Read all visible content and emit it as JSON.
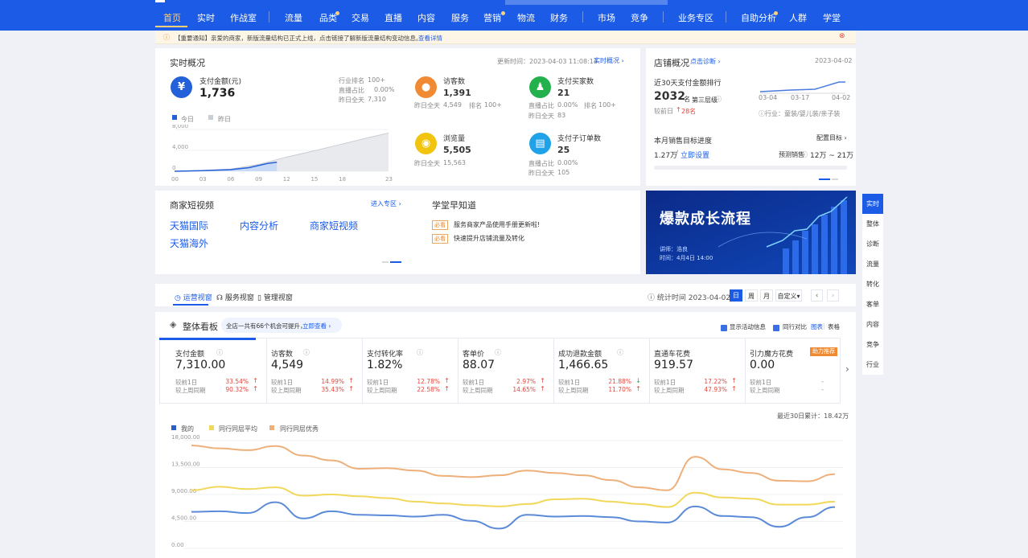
{
  "nav": {
    "items": [
      "首页",
      "实时",
      "作战室",
      "流量",
      "品类",
      "交易",
      "直播",
      "内容",
      "服务",
      "营销",
      "物流",
      "财务",
      "市场",
      "竞争",
      "业务专区",
      "自助分析",
      "人群",
      "学堂"
    ]
  },
  "notice": {
    "text": "【重要通知】亲爱的商家，新版流量结构已正式上线，点击链接了解新版流量结构变动信息。",
    "link": "查看详情"
  },
  "realtime": {
    "title": "实时概况",
    "update_time": "更新时间：2023-04-03 11:08:14",
    "link": "实时概况",
    "pay_amount": {
      "label": "支付金额(元)",
      "value": "1,736",
      "rank_label": "行业排名",
      "rank": "100+",
      "live_label": "直播占比",
      "live": "0.00%",
      "yday_label": "昨日全天",
      "yday": "7,310"
    },
    "visitors": {
      "label": "访客数",
      "value": "1,391",
      "yday_label": "昨日全天",
      "yday": "4,549",
      "rank_label": "排名",
      "rank": "100+"
    },
    "buyers": {
      "label": "支付买家数",
      "value": "21",
      "live_label": "直播占比",
      "live": "0.00%",
      "rank_label": "排名",
      "rank": "100+",
      "yday_label": "昨日全天",
      "yday": "83"
    },
    "views": {
      "label": "浏览量",
      "value": "5,505",
      "yday_label": "昨日全天",
      "yday": "15,563"
    },
    "suborders": {
      "label": "支付子订单数",
      "value": "25",
      "live_label": "直播占比",
      "live": "0.00%",
      "yday_label": "昨日全天",
      "yday": "105"
    },
    "legend": {
      "today": "今日",
      "yesterday": "昨日"
    },
    "icons": {
      "pay": "yen-icon",
      "visitors": "footprint-icon",
      "buyers": "users-icon",
      "views": "eye-icon",
      "suborders": "order-icon"
    }
  },
  "mini_chart": {
    "type": "area",
    "x_ticks": [
      "00",
      "03",
      "06",
      "09",
      "12",
      "15",
      "18",
      "23"
    ],
    "y_ticks": [
      "8,000",
      "4,000",
      "0"
    ],
    "ylim": [
      0,
      8000
    ],
    "today": [
      {
        "h": 0,
        "v": 0
      },
      {
        "h": 3,
        "v": 120
      },
      {
        "h": 6,
        "v": 300
      },
      {
        "h": 8,
        "v": 700
      },
      {
        "h": 9,
        "v": 1100
      },
      {
        "h": 10,
        "v": 1500
      },
      {
        "h": 11,
        "v": 1736
      }
    ],
    "yesterday": [
      {
        "h": 0,
        "v": 0
      },
      {
        "h": 3,
        "v": 150
      },
      {
        "h": 6,
        "v": 400
      },
      {
        "h": 9,
        "v": 1300
      },
      {
        "h": 12,
        "v": 2700
      },
      {
        "h": 15,
        "v": 3900
      },
      {
        "h": 18,
        "v": 5200
      },
      {
        "h": 21,
        "v": 6500
      },
      {
        "h": 23,
        "v": 7310
      }
    ]
  },
  "shop": {
    "title": "店铺概况",
    "diag": "点击诊断",
    "date": "2023-04-02",
    "rank_title": "近30天支付金额排行",
    "rank": "2032",
    "rank_unit": "名",
    "tier": "第三层级",
    "compare": "较前日",
    "change": "28名",
    "spark_dates": [
      "03-04",
      "03-17",
      "04-02"
    ],
    "industry": "行业：童装/婴儿装/亲子装",
    "target_title": "本月销售目标进度",
    "target_link": "配置目标",
    "amount": "1.27万",
    "set_link": "立即设置",
    "forecast_label": "预测销售",
    "forecast": "12万 ~ 21万"
  },
  "video": {
    "title": "商家短视频",
    "link": "进入专区",
    "items": [
      "天猫国际",
      "内容分析",
      "商家短视频",
      "天猫海外"
    ]
  },
  "school": {
    "title": "学堂早知道",
    "tag": "必看",
    "items": [
      "服务商家产品使用手册更新啦!",
      "快速提升店铺流量及转化"
    ]
  },
  "banner": {
    "title": "爆款成长流程",
    "speaker": "讲师：浩良",
    "time": "时间：4月4日 14:00"
  },
  "tabs": {
    "items": [
      "运营视窗",
      "服务视窗",
      "管理视窗"
    ],
    "stat_time": "统计时间 2023-04-02",
    "periods": [
      "日",
      "周",
      "月",
      "自定义"
    ]
  },
  "board": {
    "title": "整体看板",
    "tip": "全店一共有66个机会可提升，",
    "tip_link": "立即查看",
    "show_activity": "显示活动信息",
    "peer_compare": "同行对比",
    "view_chart": "图表",
    "view_table": "表格",
    "kpis": [
      {
        "name": "支付金额",
        "value": "7,310.00",
        "c1": "较前1日",
        "p1": "33.54%",
        "c2": "较上周同期",
        "p2": "90.32%"
      },
      {
        "name": "访客数",
        "value": "4,549",
        "c1": "较前1日",
        "p1": "14.99%",
        "c2": "较上周同期",
        "p2": "35.43%"
      },
      {
        "name": "支付转化率",
        "value": "1.82%",
        "c1": "较前1日",
        "p1": "12.78%",
        "c2": "较上周同期",
        "p2": "22.58%"
      },
      {
        "name": "客单价",
        "value": "88.07",
        "c1": "较前1日",
        "p1": "2.97%",
        "c2": "较上周同期",
        "p2": "14.65%"
      },
      {
        "name": "成功退款金额",
        "value": "1,466.65",
        "c1": "较前1日",
        "p1": "21.88%",
        "c2": "较上周同期",
        "p2": "11.70%"
      },
      {
        "name": "直通车花费",
        "value": "919.57",
        "c1": "较前1日",
        "p1": "17.22%",
        "c2": "较上周同期",
        "p2": "47.93%"
      },
      {
        "name": "引力魔方花费",
        "value": "0.00",
        "c1": "较前1日",
        "p1": "-",
        "c2": "较上周同期",
        "p2": "-",
        "badge": "助力推荐"
      }
    ],
    "total_30": "最近30日累计：18.42万"
  },
  "sidebar": {
    "items": [
      "实时",
      "整体",
      "诊断",
      "流量",
      "转化",
      "客单",
      "内容",
      "竞争",
      "行业"
    ]
  },
  "chart_data": {
    "type": "line",
    "y_ticks": [
      "18,000.00",
      "13,500.00",
      "9,000.00",
      "4,500.00",
      "0.00"
    ],
    "ylim": [
      0,
      18000
    ],
    "colors": {
      "mine": "#5b8ad8",
      "peer_avg": "#f2d85a",
      "peer_top": "#eeb07a"
    },
    "series": [
      {
        "name": "我的",
        "values": [
          6100,
          6200,
          5900,
          7700,
          5000,
          6200,
          5600,
          5500,
          5300,
          5600,
          4600,
          3300,
          5600,
          5300,
          5400,
          5200,
          4500,
          4300,
          7000,
          5400,
          5200,
          3600,
          5200,
          6900
        ]
      },
      {
        "name": "同行同层平均",
        "values": [
          9700,
          10300,
          9900,
          10200,
          8800,
          9000,
          8700,
          8400,
          7800,
          7500,
          7200,
          7000,
          7400,
          8200,
          8300,
          7800,
          7400,
          6900,
          9300,
          8500,
          8300,
          7300,
          7300,
          7800
        ]
      },
      {
        "name": "同行同层优秀",
        "values": [
          17200,
          16700,
          16400,
          17100,
          15500,
          14700,
          13300,
          13400,
          13000,
          12100,
          11900,
          12200,
          13000,
          12600,
          12200,
          11400,
          10200,
          9700,
          15300,
          13200,
          12600,
          11300,
          11200,
          12400
        ]
      }
    ]
  }
}
